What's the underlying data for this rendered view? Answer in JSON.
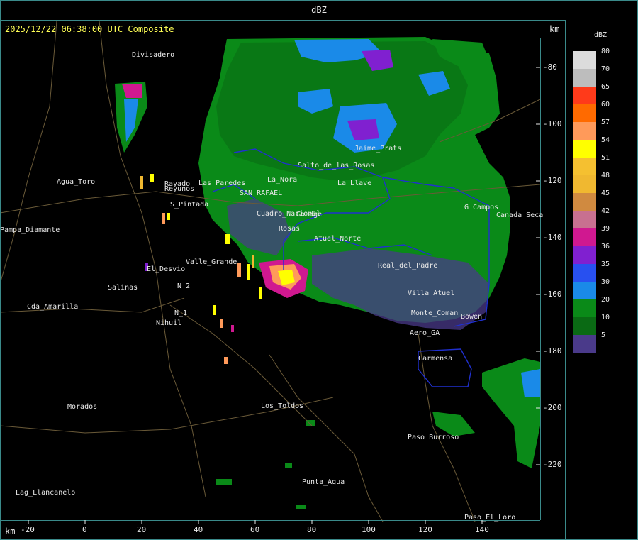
{
  "title": "dBZ",
  "timestamp": "2025/12/22 06:38:00 UTC Composite",
  "axis_unit": "km",
  "y_ticks": [
    "-80",
    "-100",
    "-120",
    "-140",
    "-160",
    "-180",
    "-200",
    "-220"
  ],
  "x_ticks": [
    "-20",
    "0",
    "20",
    "40",
    "60",
    "80",
    "100",
    "120",
    "140"
  ],
  "legend": {
    "title": "dBZ",
    "levels": [
      {
        "value": "80",
        "color": "#dcdcdc"
      },
      {
        "value": "70",
        "color": "#bdbdbd"
      },
      {
        "value": "65",
        "color": "#ff3a1a"
      },
      {
        "value": "60",
        "color": "#ff6a00"
      },
      {
        "value": "57",
        "color": "#ff9a5a"
      },
      {
        "value": "54",
        "color": "#ffff00"
      },
      {
        "value": "51",
        "color": "#f5c030"
      },
      {
        "value": "48",
        "color": "#f0b830"
      },
      {
        "value": "45",
        "color": "#d08a40"
      },
      {
        "value": "42",
        "color": "#c87090"
      },
      {
        "value": "39",
        "color": "#d01890"
      },
      {
        "value": "36",
        "color": "#8020d0"
      },
      {
        "value": "35",
        "color": "#2850f0"
      },
      {
        "value": "30",
        "color": "#1a8ae8"
      },
      {
        "value": "20",
        "color": "#0a8a18"
      },
      {
        "value": "10",
        "color": "#0a6a14"
      },
      {
        "value": "5",
        "color": "#4a3a8a"
      }
    ]
  },
  "places": [
    {
      "name": "Divisadero"
    },
    {
      "name": "Agua_Toro"
    },
    {
      "name": "Rayado"
    },
    {
      "name": "Reyunos"
    },
    {
      "name": "S_Pintada"
    },
    {
      "name": "Valle_Grande"
    },
    {
      "name": "El_Desvio"
    },
    {
      "name": "Salinas"
    },
    {
      "name": "Cda_Amarilla"
    },
    {
      "name": "Nihuil"
    },
    {
      "name": "Morados"
    },
    {
      "name": "Los_Toldos"
    },
    {
      "name": "Punta_Agua"
    },
    {
      "name": "Lag_Llancanelo"
    },
    {
      "name": "Carmensa"
    },
    {
      "name": "Paso_Burroso"
    },
    {
      "name": "Paso_El_Loro"
    },
    {
      "name": "Aero_GA"
    },
    {
      "name": "Bowen"
    },
    {
      "name": "G_Campos"
    },
    {
      "name": "SAN_RAFAEL"
    },
    {
      "name": "Pampa_Diamante"
    },
    {
      "name": "Cuadro_Nacional"
    },
    {
      "name": "Real_del_Padre"
    },
    {
      "name": "Villa_Atuel"
    },
    {
      "name": "Monte_Coman"
    },
    {
      "name": "Goudge"
    },
    {
      "name": "Rosas"
    },
    {
      "name": "La_Nora"
    },
    {
      "name": "Las_Paredes"
    },
    {
      "name": "Canada_Seca"
    },
    {
      "name": "Jaime_Prats"
    },
    {
      "name": "N_2"
    },
    {
      "name": "N_1"
    },
    {
      "name": "Salto_de_las_Rosas"
    },
    {
      "name": "Atuel_Norte"
    },
    {
      "name": "La_Llave"
    }
  ]
}
